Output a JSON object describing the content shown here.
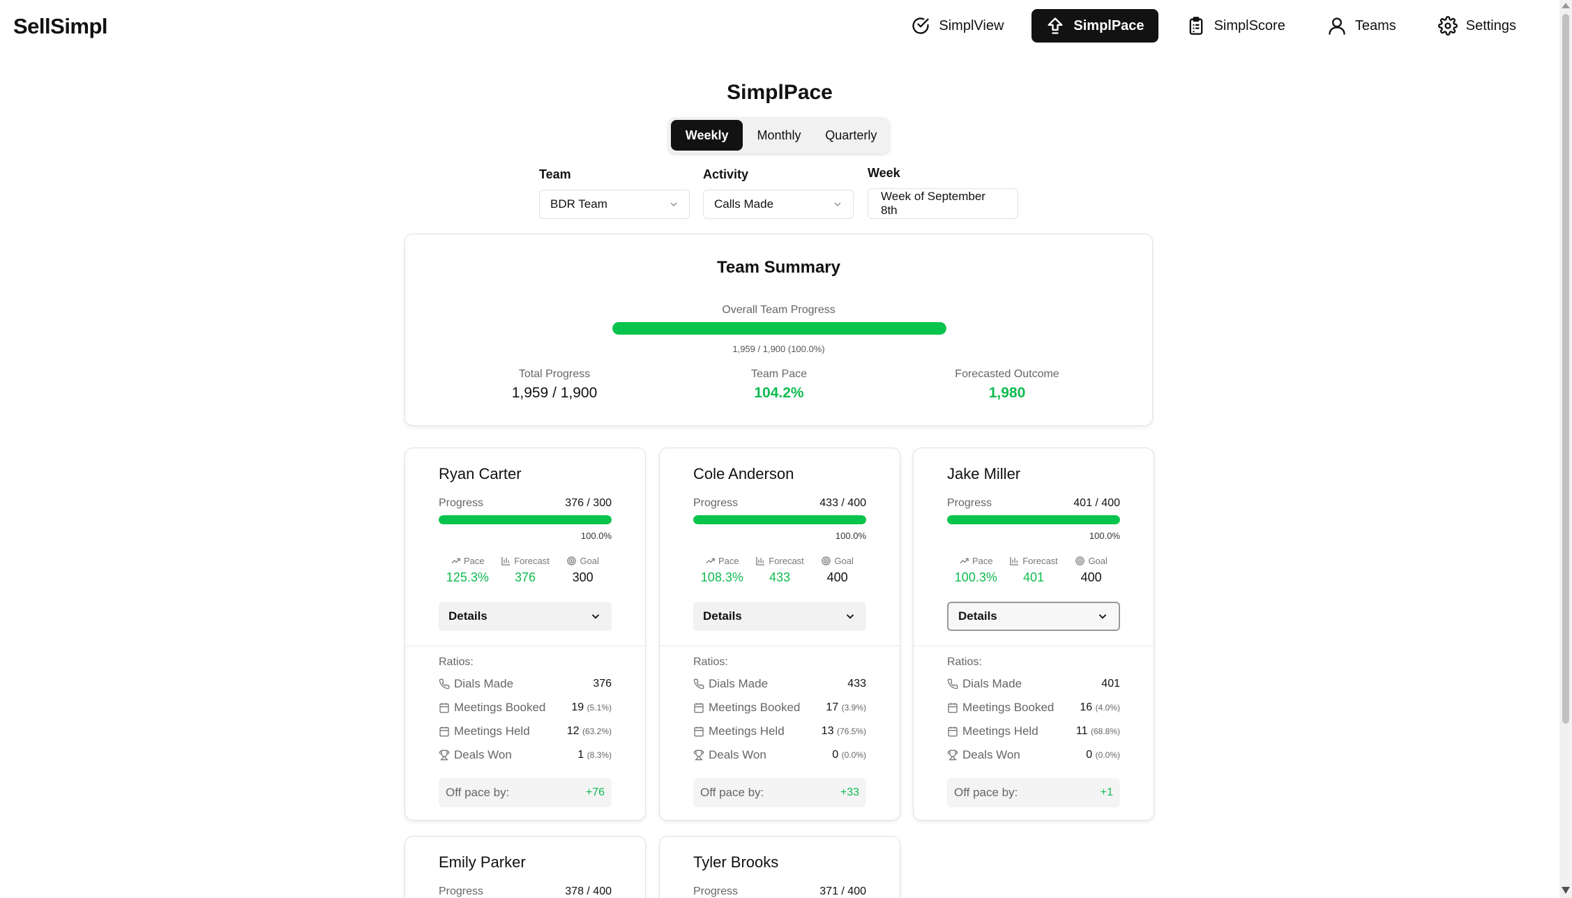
{
  "app": {
    "logo": "SellSimpl"
  },
  "nav": [
    {
      "label": "SimplView",
      "icon": "check-circle-icon",
      "active": false
    },
    {
      "label": "SimplPace",
      "icon": "upload-arrow-icon",
      "active": true
    },
    {
      "label": "SimplScore",
      "icon": "clipboard-icon",
      "active": false
    },
    {
      "label": "Teams",
      "icon": "user-icon",
      "active": false
    },
    {
      "label": "Settings",
      "icon": "gear-icon",
      "active": false
    }
  ],
  "page": {
    "title": "SimplPace"
  },
  "tabs": [
    {
      "label": "Weekly",
      "active": true
    },
    {
      "label": "Monthly",
      "active": false
    },
    {
      "label": "Quarterly",
      "active": false
    }
  ],
  "filters": {
    "team": {
      "label": "Team",
      "value": "BDR Team"
    },
    "activity": {
      "label": "Activity",
      "value": "Calls Made"
    },
    "week": {
      "label": "Week",
      "value": "Week of September 8th"
    }
  },
  "summary": {
    "title": "Team Summary",
    "overall_label": "Overall Team Progress",
    "overall_progress": 1.0,
    "overall_text": "1,959 / 1,900 (100.0%)",
    "total_label": "Total Progress",
    "total_value": "1,959 / 1,900",
    "pace_label": "Team Pace",
    "pace_value": "104.2%",
    "forecast_label": "Forecasted Outcome",
    "forecast_value": "1,980"
  },
  "labels": {
    "progress": "Progress",
    "pace": "Pace",
    "forecast": "Forecast",
    "goal": "Goal",
    "details": "Details",
    "ratios": "Ratios:",
    "dials": "Dials Made",
    "meetings_booked": "Meetings Booked",
    "meetings_held": "Meetings Held",
    "deals_won": "Deals Won",
    "off_pace": "Off pace by:"
  },
  "reps": [
    {
      "name": "Ryan Carter",
      "progress": "376 / 300",
      "progress_fraction": 1.0,
      "pct": "100.0%",
      "pace": "125.3%",
      "forecast": "376",
      "goal": "300",
      "dials": "376",
      "meetings_booked": "19",
      "meetings_booked_pct": "(5.1%)",
      "meetings_held": "12",
      "meetings_held_pct": "(63.2%)",
      "deals_won": "1",
      "deals_won_pct": "(8.3%)",
      "off_pace": "+76"
    },
    {
      "name": "Cole Anderson",
      "progress": "433 / 400",
      "progress_fraction": 1.0,
      "pct": "100.0%",
      "pace": "108.3%",
      "forecast": "433",
      "goal": "400",
      "dials": "433",
      "meetings_booked": "17",
      "meetings_booked_pct": "(3.9%)",
      "meetings_held": "13",
      "meetings_held_pct": "(76.5%)",
      "deals_won": "0",
      "deals_won_pct": "(0.0%)",
      "off_pace": "+33"
    },
    {
      "name": "Jake Miller",
      "progress": "401 / 400",
      "progress_fraction": 1.0,
      "pct": "100.0%",
      "pace": "100.3%",
      "forecast": "401",
      "goal": "400",
      "dials": "401",
      "meetings_booked": "16",
      "meetings_booked_pct": "(4.0%)",
      "meetings_held": "11",
      "meetings_held_pct": "(68.8%)",
      "deals_won": "0",
      "deals_won_pct": "(0.0%)",
      "off_pace": "+1"
    },
    {
      "name": "Emily Parker",
      "progress": "378 / 400"
    },
    {
      "name": "Tyler Brooks",
      "progress": "371 / 400"
    }
  ],
  "colors": {
    "accent_green": "#09c44c",
    "pace_green": "#0fbb50",
    "dark": "#121212"
  }
}
